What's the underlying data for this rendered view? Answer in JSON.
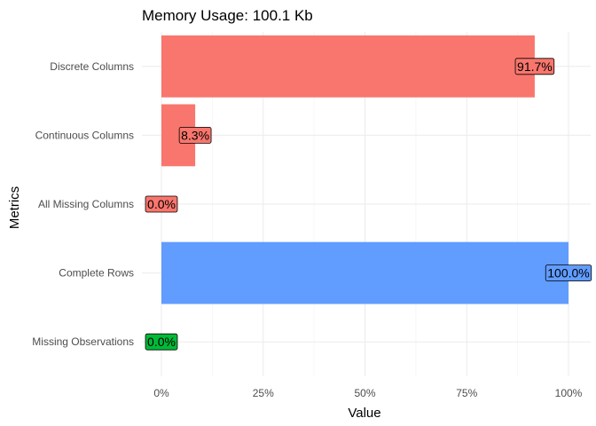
{
  "chart_data": {
    "type": "bar",
    "orientation": "horizontal",
    "title": "Memory Usage: 100.1 Kb",
    "xlabel": "Value",
    "ylabel": "Metrics",
    "xlim": [
      0,
      1
    ],
    "x_ticks": [
      "0%",
      "25%",
      "50%",
      "75%",
      "100%"
    ],
    "x_tick_values": [
      0,
      0.25,
      0.5,
      0.75,
      1.0
    ],
    "grid": true,
    "legend": "none",
    "categories": [
      "Discrete Columns",
      "Continuous Columns",
      "All Missing Columns",
      "Complete Rows",
      "Missing Observations"
    ],
    "values": [
      0.917,
      0.083,
      0.0,
      1.0,
      0.0
    ],
    "labels": [
      "91.7%",
      "8.3%",
      "0.0%",
      "100.0%",
      "0.0%"
    ],
    "colors": [
      "#F8766D",
      "#F8766D",
      "#F8766D",
      "#619CFF",
      "#00BA38"
    ]
  }
}
